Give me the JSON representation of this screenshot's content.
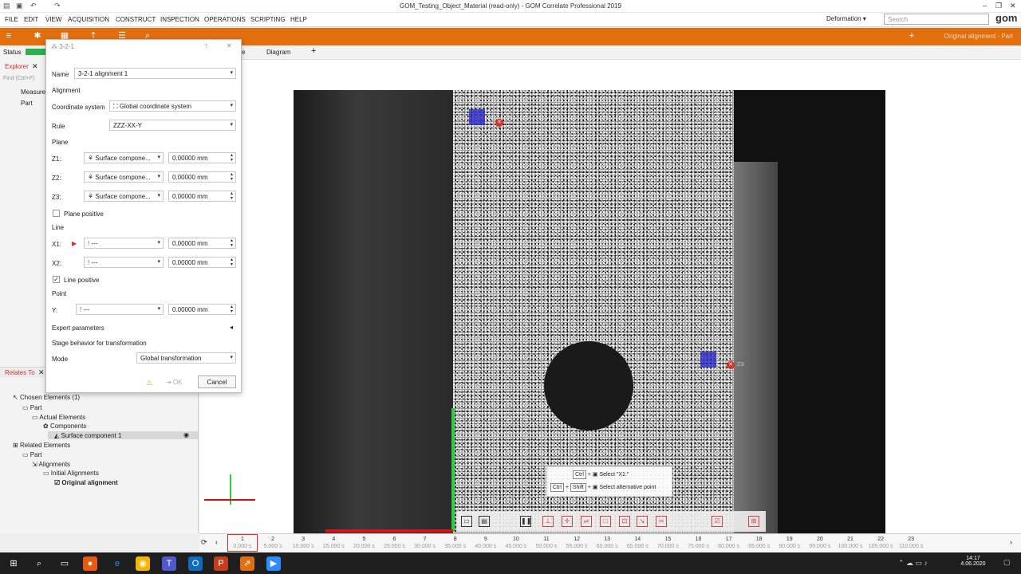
{
  "window": {
    "title": "GOM_Testing_Object_Material (read-only) - GOM Correlate Professional 2019",
    "min": "–",
    "max": "❐",
    "close": "✕"
  },
  "menu": [
    "FILE",
    "EDIT",
    "VIEW",
    "ACQUISITION",
    "CONSTRUCT",
    "INSPECTION",
    "OPERATIONS",
    "SCRIPTING",
    "HELP"
  ],
  "workspace": "Deformation",
  "search_placeholder": "Search",
  "logo": "gom",
  "toolbar": {
    "alignment": "Original alignment - Part"
  },
  "left": {
    "status": "Status",
    "explorer": "Explorer",
    "find_placeholder": "Find (Ctrl+F)",
    "tree": [
      "Measure",
      "Part"
    ],
    "relates_to": "Relates To",
    "chosen": "Chosen Elements (1)",
    "part": "Part",
    "actual": "Actual Elements",
    "components": "Components",
    "surface": "Surface component 1",
    "related": "Related Elements",
    "part2": "Part",
    "alignments": "Alignments",
    "initial": "Initial Alignments",
    "original": "Original alignment"
  },
  "view": {
    "tab1": "e",
    "tab2": "Diagram",
    "add": "+"
  },
  "dialog": {
    "title": "3-2-1",
    "name_label": "Name",
    "name_value": "3-2-1 alignment 1",
    "sec_alignment": "Alignment",
    "cs_label": "Coordinate system",
    "cs_value": "Global coordinate system",
    "rule_label": "Rule",
    "rule_value": "ZZZ-XX-Y",
    "sec_plane": "Plane",
    "z1": "Z1:",
    "z2": "Z2:",
    "z3": "Z3:",
    "surface": "Surface compone...",
    "mm": "0.00000 mm",
    "plane_positive": "Plane positive",
    "sec_line": "Line",
    "x1": "X1:",
    "x2": "X2:",
    "dashes": "---",
    "line_positive": "Line positive",
    "sec_point": "Point",
    "y": "Y:",
    "expert": "Expert parameters",
    "stage": "Stage behavior for transformation",
    "mode_label": "Mode",
    "mode_value": "Global transformation",
    "ok": "OK",
    "cancel": "Cancel"
  },
  "overlay": {
    "z3": "Z3:",
    "ctrl": "Ctrl",
    "shift": "Shift",
    "select_x1": "Select \"X1:\"",
    "select_alt": "Select alternative point"
  },
  "timeline": [
    {
      "n": "1",
      "t": "0.000 s"
    },
    {
      "n": "2",
      "t": "5.000 s"
    },
    {
      "n": "3",
      "t": "10.000 s"
    },
    {
      "n": "4",
      "t": "15.000 s"
    },
    {
      "n": "5",
      "t": "20.000 s"
    },
    {
      "n": "6",
      "t": "25.000 s"
    },
    {
      "n": "7",
      "t": "30.000 s"
    },
    {
      "n": "8",
      "t": "35.000 s"
    },
    {
      "n": "9",
      "t": "40.000 s"
    },
    {
      "n": "10",
      "t": "45.000 s"
    },
    {
      "n": "11",
      "t": "50.000 s"
    },
    {
      "n": "12",
      "t": "55.000 s"
    },
    {
      "n": "13",
      "t": "60.000 s"
    },
    {
      "n": "14",
      "t": "65.000 s"
    },
    {
      "n": "15",
      "t": "70.000 s"
    },
    {
      "n": "16",
      "t": "75.000 s"
    },
    {
      "n": "17",
      "t": "80.000 s"
    },
    {
      "n": "18",
      "t": "85.000 s"
    },
    {
      "n": "19",
      "t": "90.000 s"
    },
    {
      "n": "20",
      "t": "95.000 s"
    },
    {
      "n": "21",
      "t": "100.000 s"
    },
    {
      "n": "22",
      "t": "105.000 s"
    },
    {
      "n": "23",
      "t": "110.000 s"
    }
  ],
  "clock": {
    "time": "14:17",
    "date": "4.06.2020"
  },
  "colors": {
    "toolbar": "#e26e0e",
    "accent_red": "#d9302b"
  }
}
